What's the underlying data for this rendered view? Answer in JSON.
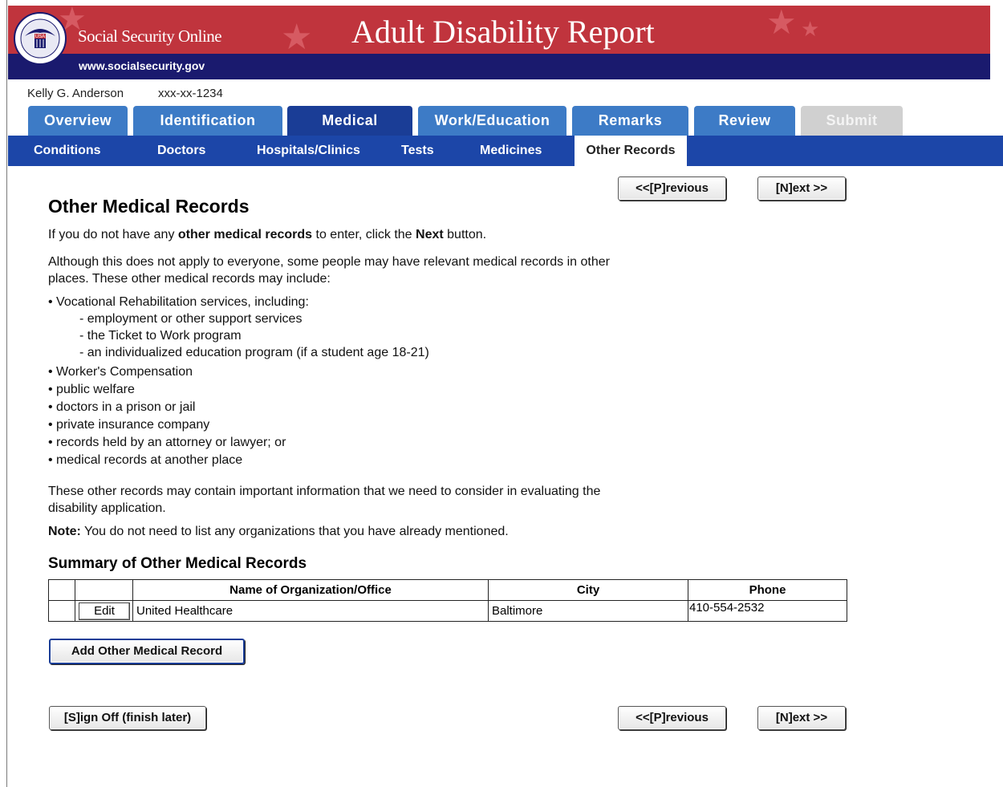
{
  "header": {
    "brand": "Social Security Online",
    "url": "www.socialsecurity.gov",
    "title": "Adult Disability Report",
    "seal_text": "USA"
  },
  "user": {
    "name": "Kelly G. Anderson",
    "ssn": "xxx-xx-1234"
  },
  "tabs": [
    {
      "label": "Overview"
    },
    {
      "label": "Identification"
    },
    {
      "label": "Medical"
    },
    {
      "label": "Work/Education"
    },
    {
      "label": "Remarks"
    },
    {
      "label": "Review"
    },
    {
      "label": "Submit"
    }
  ],
  "subtabs": [
    {
      "label": "Conditions"
    },
    {
      "label": "Doctors"
    },
    {
      "label": "Hospitals/Clinics"
    },
    {
      "label": "Tests"
    },
    {
      "label": "Medicines"
    },
    {
      "label": "Other Records"
    }
  ],
  "nav": {
    "previous": "<<[P]revious",
    "next": "[N]ext >>",
    "sign_off": "[S]ign Off (finish later)"
  },
  "content": {
    "heading": "Other Medical Records",
    "intro_pre": "If you do not have any ",
    "intro_bold": "other medical records",
    "intro_mid": " to enter, click the ",
    "intro_bold2": "Next",
    "intro_post": " button.",
    "para1_line1": "Although this does not apply to everyone, some people may have relevant medical records in other",
    "para1_line2": "places. These other medical records may include:",
    "bullets": [
      "• Vocational Rehabilitation services, including:",
      "- employment or other support services",
      "- the Ticket to  Work program",
      "- an individualized education program (if a student age 18-21)",
      "• Worker's Compensation",
      "• public welfare",
      "• doctors in a prison or jail",
      "• private insurance company",
      "• records held by an attorney or lawyer; or",
      "• medical records at another place"
    ],
    "para2_line1": "These other records may contain important information that we need to consider in evaluating the",
    "para2_line2": "disability application.",
    "note_label": "Note:",
    "note_text": " You do not need to list any organizations that you have already mentioned.",
    "summary_heading": "Summary of Other Medical Records"
  },
  "table": {
    "headers": [
      "",
      "",
      "Name of Organization/Office",
      "City",
      "Phone"
    ],
    "rows": [
      {
        "edit": "Edit",
        "name": "United Healthcare",
        "city": "Baltimore",
        "phone": "410-554-2532"
      }
    ]
  },
  "add_button": "Add Other Medical Record"
}
